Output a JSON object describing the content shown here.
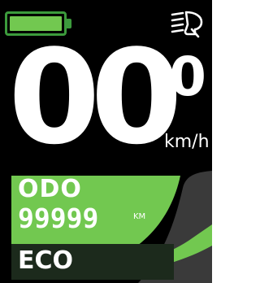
{
  "status_bar": {
    "battery_icon": "battery-icon",
    "battery_level": 1.0,
    "headlight_icon": "headlight-icon"
  },
  "speed": {
    "integer": "00",
    "decimal": "0",
    "unit": "km/h"
  },
  "odometer": {
    "label": "ODO",
    "value": "99999",
    "unit": "KM"
  },
  "mode": {
    "label": "ECO"
  },
  "colors": {
    "background": "#000000",
    "accent_green": "#72c850",
    "battery_border": "#3c9b3c",
    "arc_dark": "#3a3a3a",
    "text": "#ffffff"
  }
}
